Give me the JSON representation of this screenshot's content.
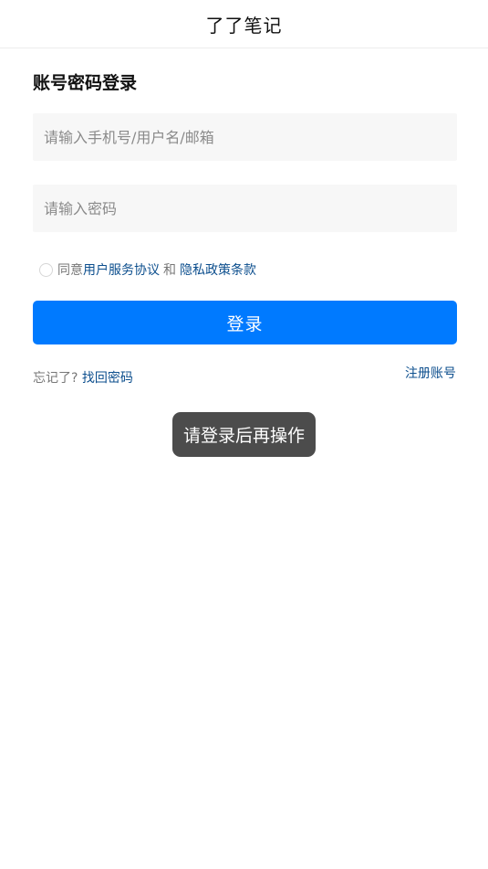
{
  "navbar": {
    "title": "了了笔记"
  },
  "login": {
    "section_title": "账号密码登录",
    "username_placeholder": "请输入手机号/用户名/邮箱",
    "password_placeholder": "请输入密码",
    "agree_prefix": "同意",
    "terms_link": "用户服务协议",
    "and_text": "和",
    "privacy_link": "隐私政策条款",
    "login_button": "登录",
    "forgot_prefix": "忘记了?",
    "recover_link": "找回密码",
    "register_link": "注册账号"
  },
  "toast": {
    "message": "请登录后再操作"
  },
  "colors": {
    "primary": "#007aff",
    "link": "#0d4f8e",
    "toast_bg": "#4c4c4c"
  }
}
